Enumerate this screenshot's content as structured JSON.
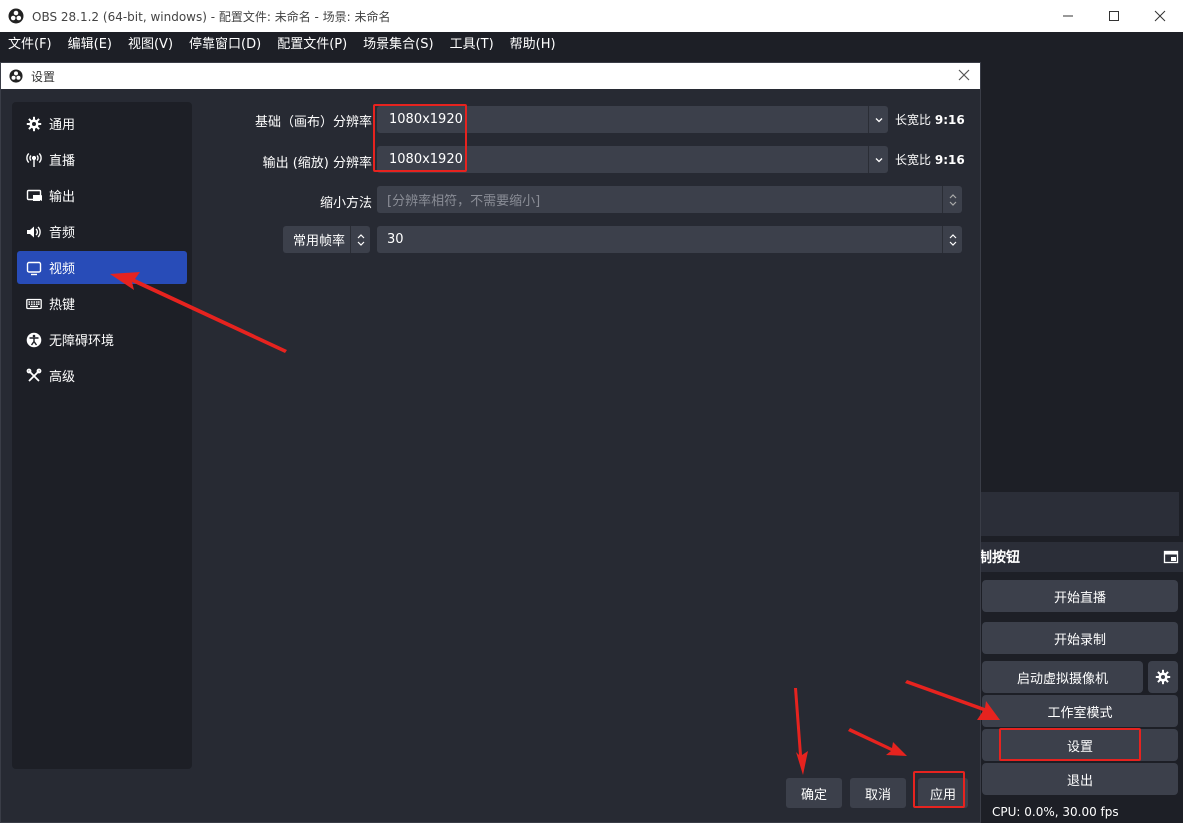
{
  "window": {
    "title": "OBS 28.1.2 (64-bit, windows) - 配置文件: 未命名 - 场景: 未命名"
  },
  "menu": [
    {
      "label": "文件(F)"
    },
    {
      "label": "编辑(E)"
    },
    {
      "label": "视图(V)"
    },
    {
      "label": "停靠窗口(D)"
    },
    {
      "label": "配置文件(P)"
    },
    {
      "label": "场景集合(S)"
    },
    {
      "label": "工具(T)"
    },
    {
      "label": "帮助(H)"
    }
  ],
  "controls": {
    "header": "制按钮",
    "start_stream": "开始直播",
    "start_record": "开始录制",
    "virtual_cam": "启动虚拟摄像机",
    "studio_mode": "工作室模式",
    "settings": "设置",
    "exit": "退出"
  },
  "status": {
    "cpu": "CPU: 0.0%, 30.00 fps"
  },
  "dialog": {
    "title": "设置",
    "nav": [
      {
        "label": "通用",
        "icon": "gear-icon"
      },
      {
        "label": "直播",
        "icon": "broadcast-icon"
      },
      {
        "label": "输出",
        "icon": "output-icon"
      },
      {
        "label": "音频",
        "icon": "speaker-icon"
      },
      {
        "label": "视频",
        "icon": "monitor-icon",
        "active": true
      },
      {
        "label": "热键",
        "icon": "keyboard-icon"
      },
      {
        "label": "无障碍环境",
        "icon": "accessibility-icon"
      },
      {
        "label": "高级",
        "icon": "tools-icon"
      }
    ],
    "video": {
      "base_label": "基础（画布）分辨率",
      "base_value": "1080x1920",
      "base_aspect_prefix": "长宽比",
      "base_aspect_value": "9:16",
      "output_label": "输出 (缩放) 分辨率",
      "output_value": "1080x1920",
      "output_aspect_prefix": "长宽比",
      "output_aspect_value": "9:16",
      "downscale_label": "缩小方法",
      "downscale_value": "[分辨率相符，不需要缩小]",
      "fps_type": "常用帧率",
      "fps_value": "30"
    },
    "buttons": {
      "ok": "确定",
      "cancel": "取消",
      "apply": "应用"
    }
  },
  "colors": {
    "accent": "#284cb8",
    "annotation": "#e6231f",
    "panel": "#272a33",
    "control": "#3c404b"
  }
}
